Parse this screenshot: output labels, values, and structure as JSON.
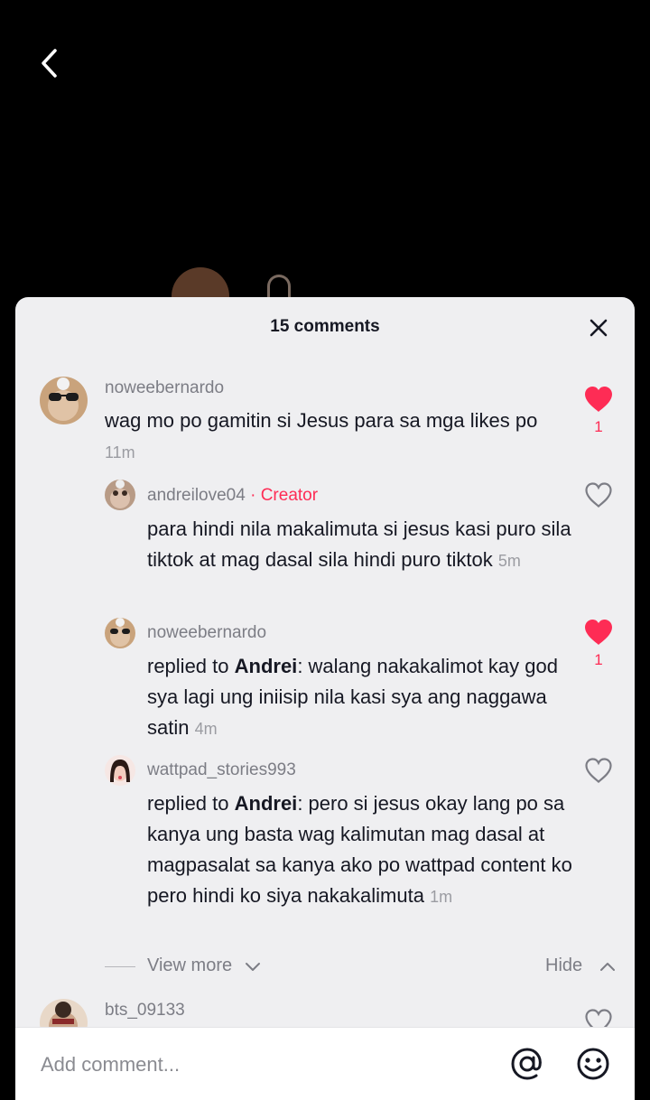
{
  "colors": {
    "accent": "#fe2c55",
    "text": "#161823",
    "muted": "#7c7d85",
    "sheet_bg": "#efeff1"
  },
  "header": {
    "title": "15 comments",
    "back_icon": "chevron-left-icon",
    "close_icon": "close-icon"
  },
  "comments": [
    {
      "username": "noweebernardo",
      "text": "wag mo po gamitin si Jesus para sa mga likes po",
      "time": "11m",
      "liked": true,
      "likes": "1",
      "replies": [
        {
          "username": "andreilove04",
          "badge": "· Creator",
          "text": "para hindi nila makalimuta si jesus kasi puro sila tiktok at mag dasal sila hindi puro tiktok",
          "time": "5m",
          "liked": false
        },
        {
          "username": "noweebernardo",
          "prefix": "replied to ",
          "mention": "Andrei",
          "text": ": walang nakakalimot kay god sya lagi ung iniisip nila kasi sya ang naggawa satin",
          "time": "4m",
          "liked": true,
          "likes": "1"
        },
        {
          "username": "wattpad_stories993",
          "prefix": "replied to ",
          "mention": "Andrei",
          "text": ": pero si jesus okay lang po sa kanya ung basta wag kalimutan mag dasal at magpasalat sa kanya ako po wattpad content ko pero hindi ko siya nakakalimuta",
          "time": "1m",
          "liked": false
        }
      ],
      "view_more": "View more",
      "hide": "Hide"
    },
    {
      "username": "bts_09133",
      "liked": false
    }
  ],
  "input": {
    "placeholder": "Add comment...",
    "mention_icon": "at-sign-icon",
    "emoji_icon": "emoji-icon"
  }
}
